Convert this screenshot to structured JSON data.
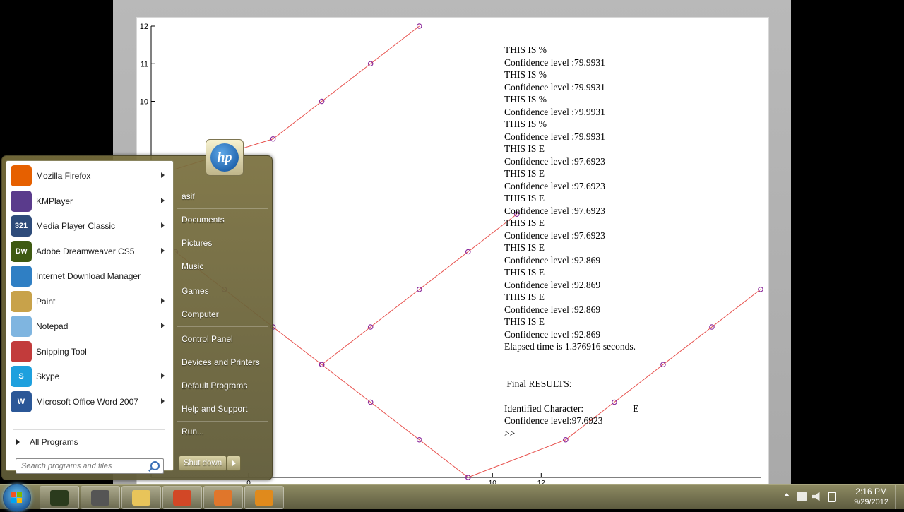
{
  "plot": {
    "y_ticks": [
      "12",
      "11",
      "10"
    ],
    "x_ticks": [
      "0",
      "10",
      "12"
    ],
    "colors": {
      "line": "#e8534f",
      "marker": "#8b2a9b",
      "axis": "#000000"
    },
    "series": [
      {
        "points": [
          [
            -4,
            8.0
          ],
          [
            1,
            9.0
          ],
          [
            3,
            10.0
          ],
          [
            5,
            11.0
          ],
          [
            7,
            12.0
          ]
        ]
      },
      {
        "points": [
          [
            3,
            3.0
          ],
          [
            5,
            4.0
          ],
          [
            7,
            5.0
          ],
          [
            9,
            6.0
          ],
          [
            11,
            7.0
          ]
        ]
      },
      {
        "points": [
          [
            3,
            3.0
          ],
          [
            1,
            4.0
          ],
          [
            -1,
            5.0
          ],
          [
            -3,
            6.0
          ]
        ]
      },
      {
        "points": [
          [
            3,
            3.0
          ],
          [
            5,
            2.0
          ],
          [
            7,
            1.0
          ],
          [
            9,
            0.0
          ]
        ]
      },
      {
        "points": [
          [
            9,
            0.0
          ],
          [
            13,
            1.0
          ],
          [
            15,
            2.0
          ],
          [
            17,
            3.0
          ],
          [
            19,
            4.0
          ],
          [
            21,
            5.0
          ]
        ]
      }
    ]
  },
  "console": {
    "lines": [
      "THIS IS %",
      "Confidence level :79.9931",
      "THIS IS %",
      "Confidence level :79.9931",
      "THIS IS %",
      "Confidence level :79.9931",
      "THIS IS %",
      "Confidence level :79.9931",
      "THIS IS E",
      "Confidence level :97.6923",
      "THIS IS E",
      "Confidence level :97.6923",
      "THIS IS E",
      "Confidence level :97.6923",
      "THIS IS E",
      "Confidence level :97.6923",
      "THIS IS E",
      "Confidence level :92.869",
      "THIS IS E",
      "Confidence level :92.869",
      "THIS IS E",
      "Confidence level :92.869",
      "THIS IS E",
      "Confidence level :92.869",
      "Elapsed time is 1.376916 seconds."
    ],
    "final_results": " Final RESULTS:",
    "identified_label": "Identified Character:",
    "identified_value": "E",
    "final_confidence": "Confidence level:97.6923",
    "prompt": ">>"
  },
  "start_menu": {
    "programs": [
      {
        "label": "Mozilla Firefox",
        "icon": "firefox-icon",
        "color": "#e66000",
        "glyph": "",
        "arrow": true
      },
      {
        "label": "KMPlayer",
        "icon": "kmplayer-icon",
        "color": "#5a3b8c",
        "glyph": "",
        "arrow": true
      },
      {
        "label": "Media Player Classic",
        "icon": "media-player-classic-icon",
        "color": "#2e4b7a",
        "glyph": "321",
        "arrow": true
      },
      {
        "label": "Adobe Dreamweaver CS5",
        "icon": "dreamweaver-icon",
        "color": "#3e5a12",
        "glyph": "Dw",
        "arrow": true
      },
      {
        "label": "Internet Download Manager",
        "icon": "idm-icon",
        "color": "#2f7fc4",
        "glyph": "",
        "arrow": false
      },
      {
        "label": "Paint",
        "icon": "paint-icon",
        "color": "#c8a24a",
        "glyph": "",
        "arrow": true
      },
      {
        "label": "Notepad",
        "icon": "notepad-icon",
        "color": "#7fb5e0",
        "glyph": "",
        "arrow": true
      },
      {
        "label": "Snipping Tool",
        "icon": "snipping-tool-icon",
        "color": "#c23b3b",
        "glyph": "",
        "arrow": false
      },
      {
        "label": "Skype",
        "icon": "skype-icon",
        "color": "#1ea0de",
        "glyph": "S",
        "arrow": true
      },
      {
        "label": "Microsoft Office Word 2007",
        "icon": "word-icon",
        "color": "#2b5797",
        "glyph": "W",
        "arrow": true
      }
    ],
    "all_programs": "All Programs",
    "search_placeholder": "Search programs and files",
    "right_items": [
      "asif",
      "Documents",
      "Pictures",
      "Music",
      "Games",
      "Computer",
      "Control Panel",
      "Devices and Printers",
      "Default Programs",
      "Help and Support",
      "Run..."
    ],
    "shutdown": "Shut down",
    "user_logo_text": "hp"
  },
  "taskbar": {
    "apps": [
      {
        "name": "taskbar-app-media-center",
        "icon": "media-center-icon",
        "color": "#2b3b1d"
      },
      {
        "name": "taskbar-app-microphone",
        "icon": "microphone-icon",
        "color": "#555555"
      },
      {
        "name": "taskbar-app-explorer",
        "icon": "folder-icon",
        "color": "#e8c45a"
      },
      {
        "name": "taskbar-app-powerpoint",
        "icon": "powerpoint-icon",
        "color": "#d24726"
      },
      {
        "name": "taskbar-app-matlab",
        "icon": "matlab-icon",
        "color": "#e0762b"
      },
      {
        "name": "taskbar-app-media-player",
        "icon": "media-player-icon",
        "color": "#e08a1c"
      }
    ],
    "time": "2:16 PM",
    "date": "9/29/2012"
  }
}
